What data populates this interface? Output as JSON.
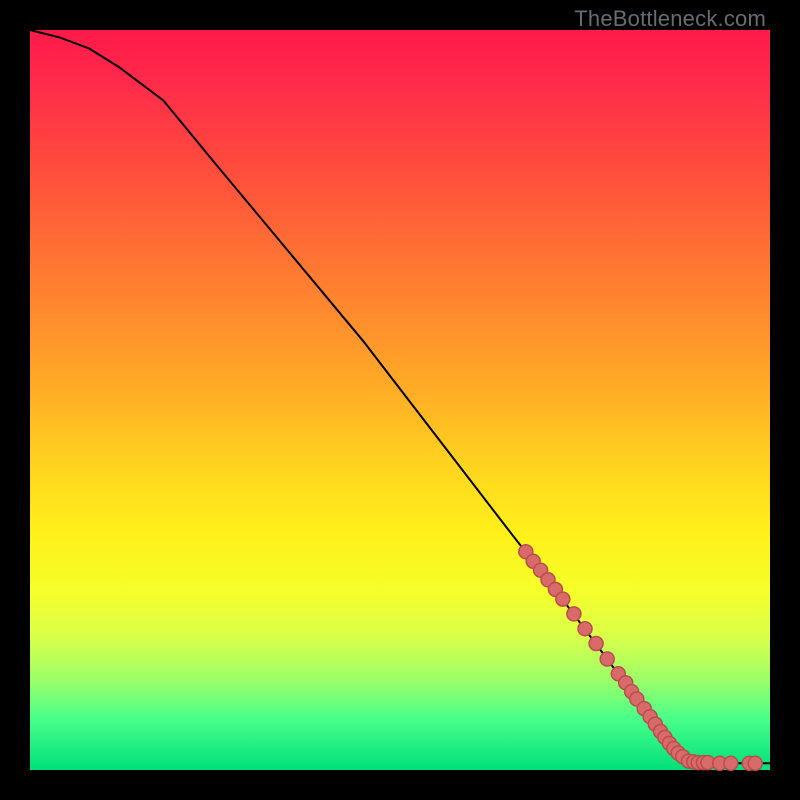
{
  "watermark": "TheBottleneck.com",
  "chart_data": {
    "type": "line",
    "title": "",
    "xlabel": "",
    "ylabel": "",
    "xlim": [
      0,
      100
    ],
    "ylim": [
      0,
      100
    ],
    "curve": [
      {
        "x": 0,
        "y": 100
      },
      {
        "x": 4,
        "y": 99
      },
      {
        "x": 8,
        "y": 97.5
      },
      {
        "x": 12,
        "y": 95
      },
      {
        "x": 18,
        "y": 90.5
      },
      {
        "x": 25,
        "y": 82
      },
      {
        "x": 35,
        "y": 70
      },
      {
        "x": 45,
        "y": 58
      },
      {
        "x": 55,
        "y": 45
      },
      {
        "x": 65,
        "y": 32
      },
      {
        "x": 72,
        "y": 23
      },
      {
        "x": 78,
        "y": 15
      },
      {
        "x": 82,
        "y": 9.5
      },
      {
        "x": 85,
        "y": 5.5
      },
      {
        "x": 87.5,
        "y": 2.8
      },
      {
        "x": 89,
        "y": 1.5
      },
      {
        "x": 90,
        "y": 1.0
      },
      {
        "x": 93,
        "y": 0.9
      },
      {
        "x": 96,
        "y": 0.9
      },
      {
        "x": 100,
        "y": 0.9
      }
    ],
    "dots_diagonal": [
      {
        "x": 67,
        "y": 29.5
      },
      {
        "x": 68,
        "y": 28.2
      },
      {
        "x": 69,
        "y": 27
      },
      {
        "x": 70,
        "y": 25.7
      },
      {
        "x": 71,
        "y": 24.4
      },
      {
        "x": 72,
        "y": 23.1
      },
      {
        "x": 73.5,
        "y": 21.1
      },
      {
        "x": 75,
        "y": 19.1
      },
      {
        "x": 76.5,
        "y": 17.1
      },
      {
        "x": 78,
        "y": 15
      },
      {
        "x": 79.5,
        "y": 13
      },
      {
        "x": 80.5,
        "y": 11.8
      },
      {
        "x": 81.3,
        "y": 10.6
      },
      {
        "x": 82,
        "y": 9.6
      },
      {
        "x": 83,
        "y": 8.3
      },
      {
        "x": 83.8,
        "y": 7.2
      },
      {
        "x": 84.5,
        "y": 6.2
      },
      {
        "x": 85.2,
        "y": 5.2
      },
      {
        "x": 85.8,
        "y": 4.4
      },
      {
        "x": 86.4,
        "y": 3.6
      },
      {
        "x": 87,
        "y": 2.9
      },
      {
        "x": 87.6,
        "y": 2.3
      },
      {
        "x": 88.2,
        "y": 1.8
      }
    ],
    "dots_baseline": [
      {
        "x": 89,
        "y": 1.2
      },
      {
        "x": 89.7,
        "y": 1.1
      },
      {
        "x": 90.3,
        "y": 1.0
      },
      {
        "x": 91,
        "y": 1.0
      },
      {
        "x": 91.6,
        "y": 1.0
      },
      {
        "x": 93.2,
        "y": 0.9
      },
      {
        "x": 94.7,
        "y": 0.9
      },
      {
        "x": 97.2,
        "y": 0.9
      },
      {
        "x": 98,
        "y": 0.9
      }
    ],
    "dot_radius_px": 7
  }
}
